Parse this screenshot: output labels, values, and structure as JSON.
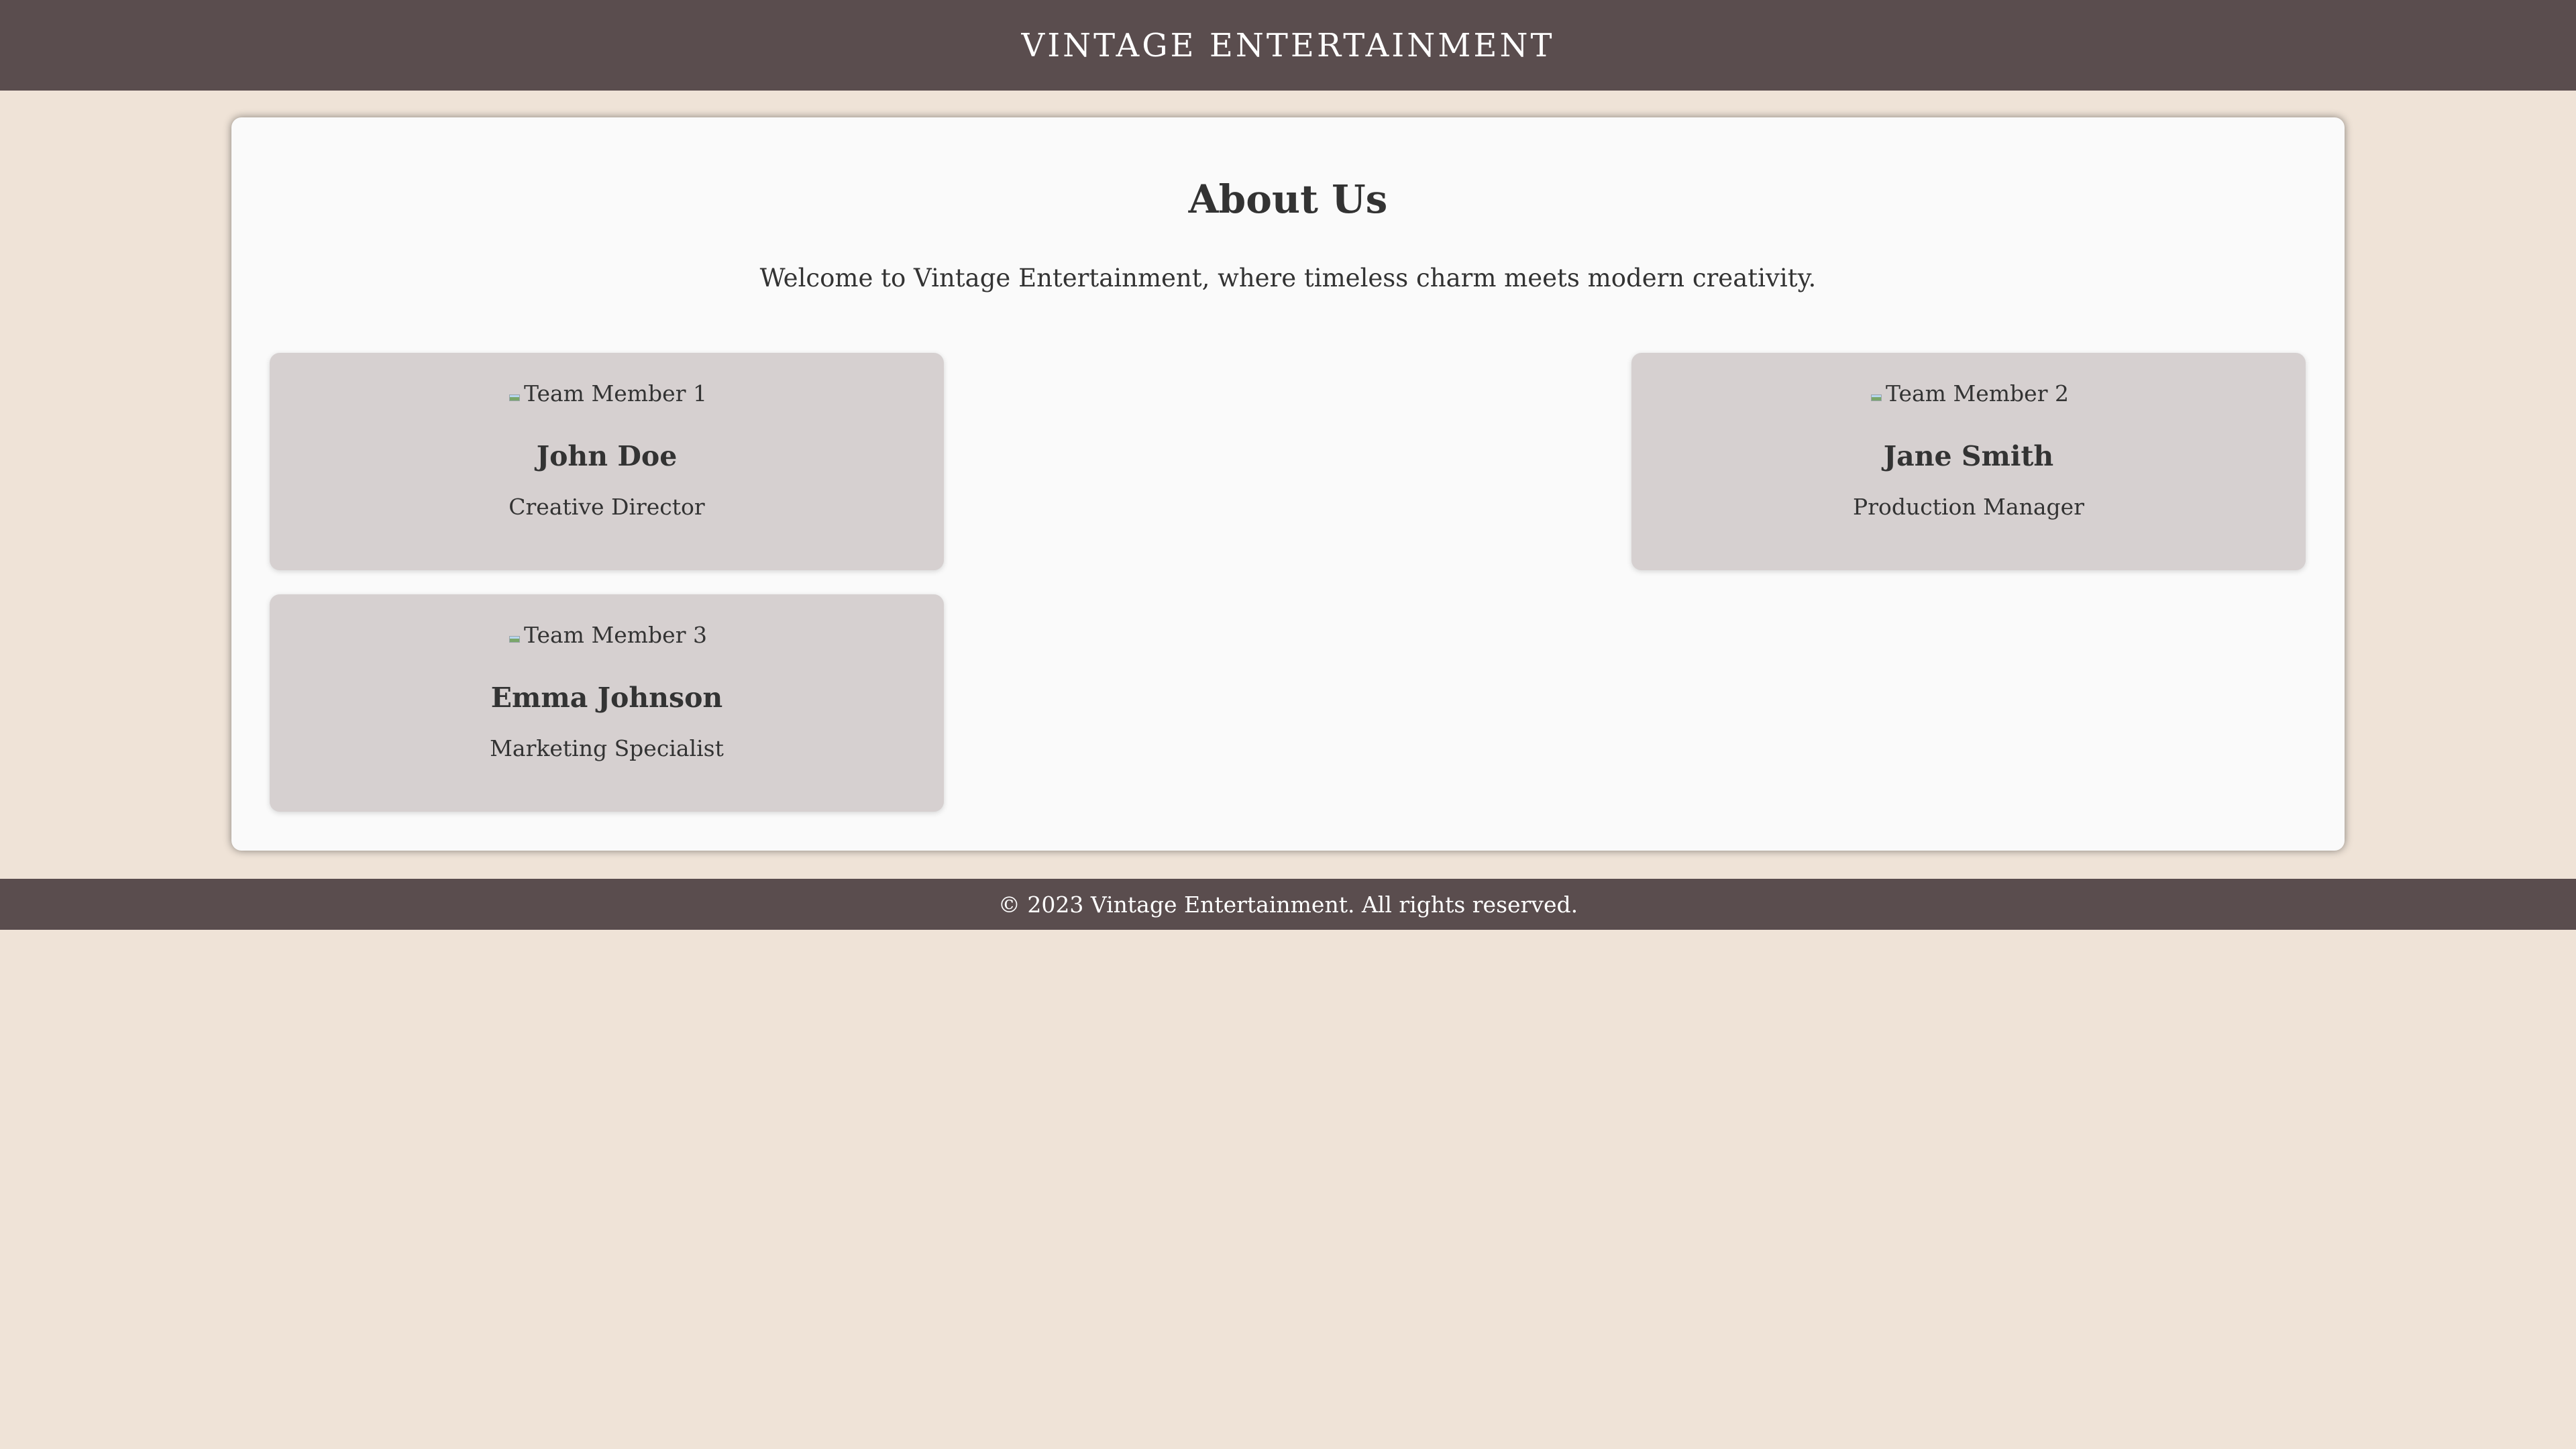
{
  "header": {
    "title": "VINTAGE ENTERTAINMENT"
  },
  "about": {
    "heading": "About Us",
    "intro": "Welcome to Vintage Entertainment, where timeless charm meets modern creativity."
  },
  "team": [
    {
      "photo_alt": "Team Member 1",
      "name": "John Doe",
      "role": "Creative Director"
    },
    {
      "photo_alt": "Team Member 2",
      "name": "Jane Smith",
      "role": "Production Manager"
    },
    {
      "photo_alt": "Team Member 3",
      "name": "Emma Johnson",
      "role": "Marketing Specialist"
    }
  ],
  "footer": {
    "copyright": "© 2023 Vintage Entertainment. All rights reserved."
  },
  "colors": {
    "page_background": "#efe3d7",
    "header_footer": "#5a4d4e",
    "panel": "#fafafa",
    "card": "#d6d0d0",
    "text": "#333333"
  },
  "icons": {
    "team_photo": "broken-image-icon"
  }
}
